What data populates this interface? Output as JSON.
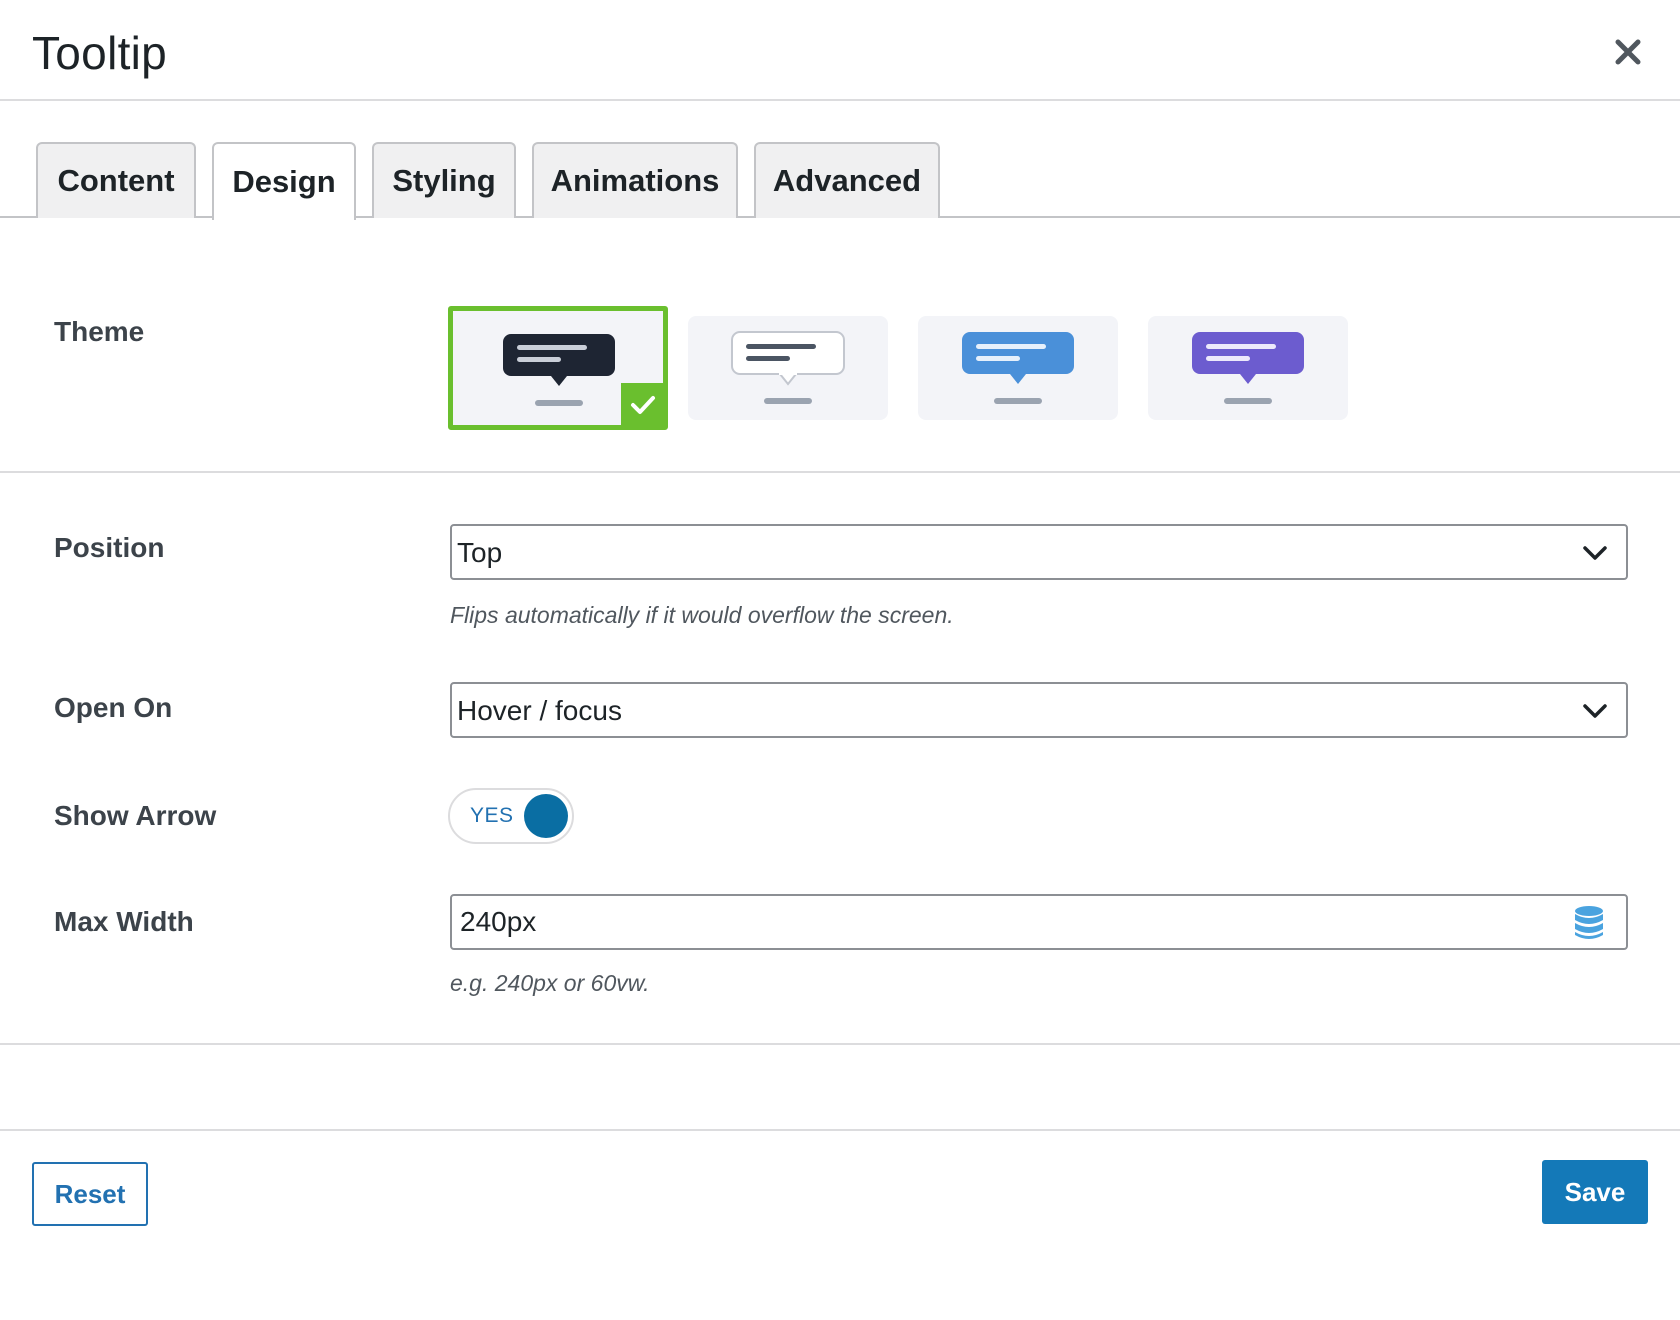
{
  "dialog": {
    "title": "Tooltip",
    "close_icon": "close-icon"
  },
  "tabs": [
    {
      "label": "Content",
      "active": false
    },
    {
      "label": "Design",
      "active": true
    },
    {
      "label": "Styling",
      "active": false
    },
    {
      "label": "Animations",
      "active": false
    },
    {
      "label": "Advanced",
      "active": false
    }
  ],
  "theme": {
    "label": "Theme",
    "options": [
      {
        "name": "dark",
        "bubble_color": "#1e2533",
        "selected": true
      },
      {
        "name": "light",
        "bubble_color": "#ffffff",
        "selected": false
      },
      {
        "name": "blue",
        "bubble_color": "#4a90d9",
        "selected": false
      },
      {
        "name": "purple",
        "bubble_color": "#6c5ccf",
        "selected": false
      }
    ],
    "selected_color": "#6abf2e"
  },
  "position": {
    "label": "Position",
    "value": "Top",
    "hint": "Flips automatically if it would overflow the screen."
  },
  "open_on": {
    "label": "Open On",
    "value": "Hover / focus"
  },
  "show_arrow": {
    "label": "Show Arrow",
    "toggle_text": "YES",
    "on": true
  },
  "max_width": {
    "label": "Max Width",
    "value": "240px",
    "hint": "e.g. 240px or 60vw.",
    "icon": "database-icon"
  },
  "footer": {
    "reset_label": "Reset",
    "save_label": "Save"
  },
  "colors": {
    "accent": "#2271b1",
    "primary_button": "#1479b8",
    "toggle_knob": "#0a6ea3"
  }
}
